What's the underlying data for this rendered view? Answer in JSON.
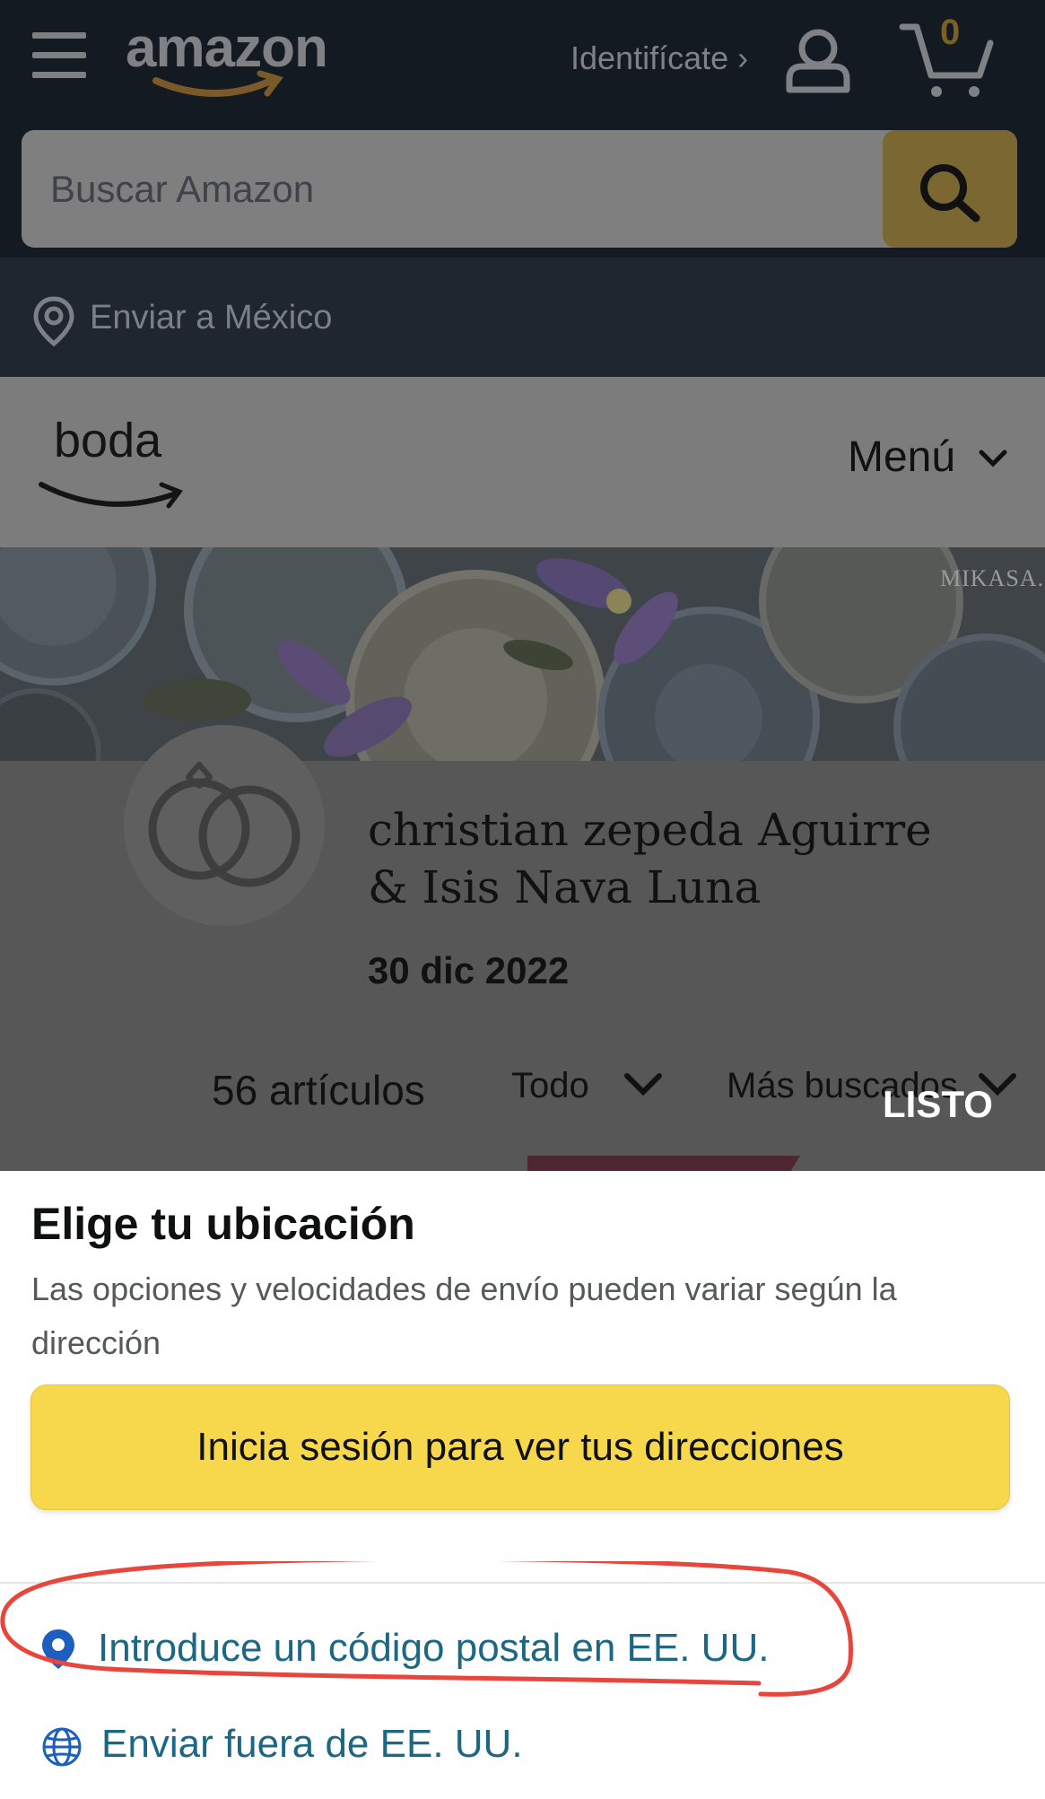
{
  "header": {
    "logo_text": "amazon",
    "signin_link": "Identifícate ›",
    "cart_count": "0",
    "search_placeholder": "Buscar Amazon",
    "deliver_to": "Enviar a México"
  },
  "registry_header": {
    "logo_text": "boda",
    "menu_label": "Menú"
  },
  "banner": {
    "brand": "MIKASA."
  },
  "registry": {
    "couple_line1": "christian zepeda Aguirre",
    "couple_line2": "& Isis Nava Luna",
    "date": "30 dic 2022",
    "article_count": "56 artículos",
    "filter_label": "Todo",
    "sort_label": "Más buscados",
    "done_button": "LISTO"
  },
  "location_sheet": {
    "title": "Elige tu ubicación",
    "description": "Las opciones y velocidades de envío pueden variar según la dirección",
    "signin_button": "Inicia sesión para ver tus direcciones",
    "zip_link": "Introduce un código postal en EE. UU.",
    "outside_link": "Enviar fuera de EE. UU."
  },
  "colors": {
    "header_bg": "#131a22",
    "accent_yellow": "#f7d84c",
    "link_blue": "#1c6783",
    "annotation_red": "#e8453c",
    "pin_blue": "#1d5fbf"
  },
  "icons": [
    "hamburger-menu-icon",
    "user-icon",
    "cart-icon",
    "search-icon",
    "location-pin-icon",
    "chevron-down-icon",
    "wedding-rings-icon",
    "globe-icon"
  ]
}
